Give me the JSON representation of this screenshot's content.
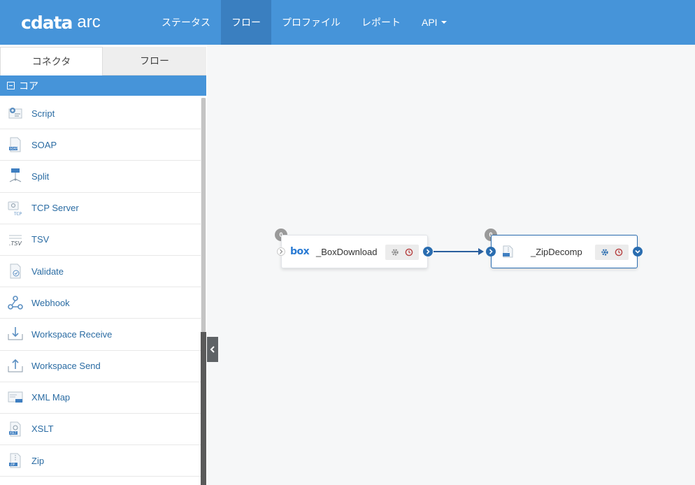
{
  "app": {
    "logo": "cdata",
    "product": "arc"
  },
  "nav": {
    "items": [
      {
        "label": "ステータス"
      },
      {
        "label": "フロー"
      },
      {
        "label": "プロファイル"
      },
      {
        "label": "レポート"
      },
      {
        "label": "API"
      }
    ],
    "active_index": 1
  },
  "sidebar": {
    "tabs": [
      {
        "label": "コネクタ"
      },
      {
        "label": "フロー"
      }
    ],
    "section_title": "コア",
    "connectors": [
      {
        "label": "Script",
        "icon": "script-icon"
      },
      {
        "label": "SOAP",
        "icon": "soap-icon"
      },
      {
        "label": "Split",
        "icon": "split-icon"
      },
      {
        "label": "TCP Server",
        "icon": "tcp-server-icon"
      },
      {
        "label": "TSV",
        "icon": "tsv-icon"
      },
      {
        "label": "Validate",
        "icon": "validate-icon"
      },
      {
        "label": "Webhook",
        "icon": "webhook-icon"
      },
      {
        "label": "Workspace Receive",
        "icon": "workspace-receive-icon"
      },
      {
        "label": "Workspace Send",
        "icon": "workspace-send-icon"
      },
      {
        "label": "XML Map",
        "icon": "xml-map-icon"
      },
      {
        "label": "XSLT",
        "icon": "xslt-icon"
      },
      {
        "label": "Zip",
        "icon": "zip-icon"
      }
    ]
  },
  "flow": {
    "nodes": [
      {
        "name": "_BoxDownload",
        "badge": "0",
        "logo": "box",
        "icon": "box-logo-icon"
      },
      {
        "name": "_ZipDecomp",
        "badge": "0",
        "icon": "zip-connector-icon",
        "selected": true
      }
    ]
  },
  "colors": {
    "navbar": "#4694d9",
    "nav_active": "#3a7fc0",
    "link": "#2b6ca3",
    "port": "#2a6db0",
    "canvas": "#f6f7f8"
  }
}
